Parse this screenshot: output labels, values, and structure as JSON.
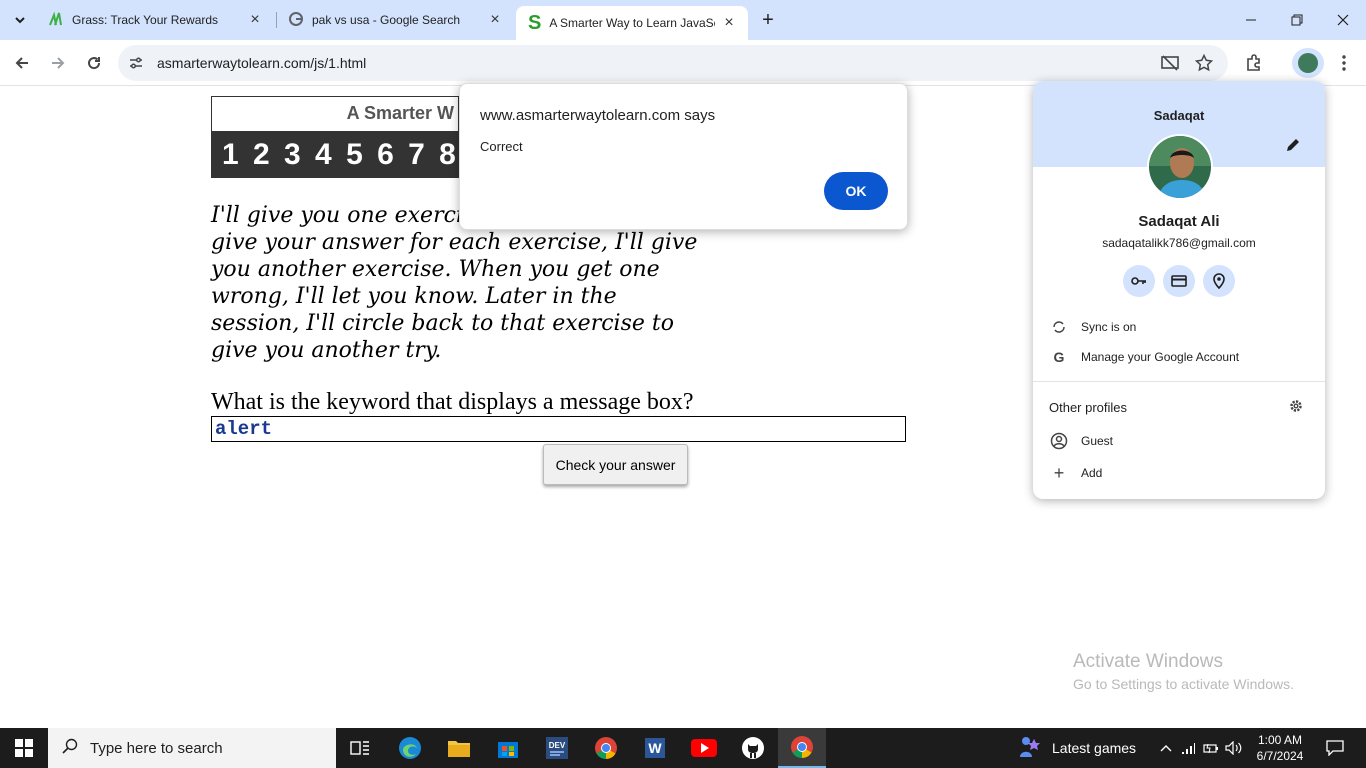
{
  "browser": {
    "tabs": [
      {
        "title": "Grass: Track Your Rewards",
        "icon": "grass-leaf-icon"
      },
      {
        "title": "pak vs usa - Google Search",
        "icon": "google-g-icon"
      },
      {
        "title": "A Smarter Way to Learn JavaScr",
        "icon": "smarter-way-s-icon",
        "active": true
      }
    ],
    "url": "asmarterwaytolearn.com/js/1.html"
  },
  "page": {
    "book_title": "A Smarter W",
    "number_strip": "1 2 3 4 5 6 7 8 9",
    "instructions_visible": "I'll give you one exercis",
    "instructions_rest": "give your answer for each exercise, I'll give you another exercise. When you get one wrong, I'll let you know. Later in the session, I'll circle back to that exercise to give you another try.",
    "question": "What is the keyword that displays a message box?",
    "answer_value": "alert",
    "check_button": "Check your answer"
  },
  "alert": {
    "origin": "www.asmarterwaytolearn.com says",
    "message": "Correct",
    "ok_label": "OK"
  },
  "profile_menu": {
    "profile_name": "Sadaqat",
    "full_name": "Sadaqat Ali",
    "email": "sadaqatalikk786@gmail.com",
    "sync": "Sync is on",
    "manage": "Manage your Google Account",
    "other_profiles": "Other profiles",
    "guest": "Guest",
    "add": "Add"
  },
  "watermark": {
    "title": "Activate Windows",
    "subtitle": "Go to Settings to activate Windows."
  },
  "taskbar": {
    "search_placeholder": "Type here to search",
    "widget_label": "Latest games",
    "time": "1:00 AM",
    "date": "6/7/2024"
  },
  "colors": {
    "tabstrip_bg": "#d3e3fd",
    "accent_blue": "#0b57d0",
    "answer_text": "#1a3a8f"
  }
}
